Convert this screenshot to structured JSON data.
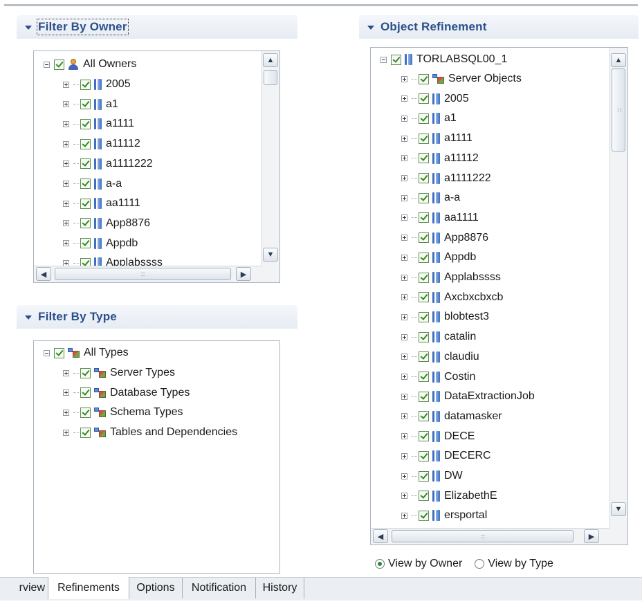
{
  "filter_by_owner": {
    "title": "Filter By Owner",
    "root": "All Owners",
    "items": [
      "2005",
      "a1",
      "a1111",
      "a11112",
      "a1111222",
      "a-a",
      "aa1111",
      "App8876",
      "Appdb",
      "Applabssss"
    ]
  },
  "filter_by_type": {
    "title": "Filter By Type",
    "root": "All Types",
    "items": [
      "Server Types",
      "Database Types",
      "Schema Types",
      "Tables and Dependencies"
    ]
  },
  "object_refinement": {
    "title": "Object Refinement",
    "root": "TORLABSQL00_1",
    "items": [
      "Server Objects",
      "2005",
      "a1",
      "a1111",
      "a11112",
      "a1111222",
      "a-a",
      "aa1111",
      "App8876",
      "Appdb",
      "Applabssss",
      "Axcbxcbxcb",
      "blobtest3",
      "catalin",
      "claudiu",
      "Costin",
      "DataExtractionJob",
      "datamasker",
      "DECE",
      "DECERC",
      "DW",
      "ElizabethE",
      "ersportal"
    ]
  },
  "view_options": {
    "by_owner": "View by Owner",
    "by_type": "View by Type",
    "selected": "View by Owner"
  },
  "tabs": {
    "overview": "rview",
    "refinements": "Refinements",
    "options": "Options",
    "notification": "Notification",
    "history": "History",
    "active": "Refinements"
  },
  "icons": {
    "collapse": "minus-box-icon",
    "expand": "plus-box-icon",
    "checkbox": "checkbox-checked-icon",
    "owner": "user-icon",
    "database": "database-icon",
    "types": "object-types-icon",
    "scroll_up": "arrow-up-icon",
    "scroll_down": "arrow-down-icon",
    "scroll_left": "arrow-left-icon",
    "scroll_right": "arrow-right-icon"
  },
  "glyphs": {
    "up": "▲",
    "down": "▼",
    "left": "◀",
    "right": "▶"
  },
  "colors": {
    "header_text": "#2b4f8a",
    "check": "#2e8b1f",
    "border": "#a9b3be"
  }
}
